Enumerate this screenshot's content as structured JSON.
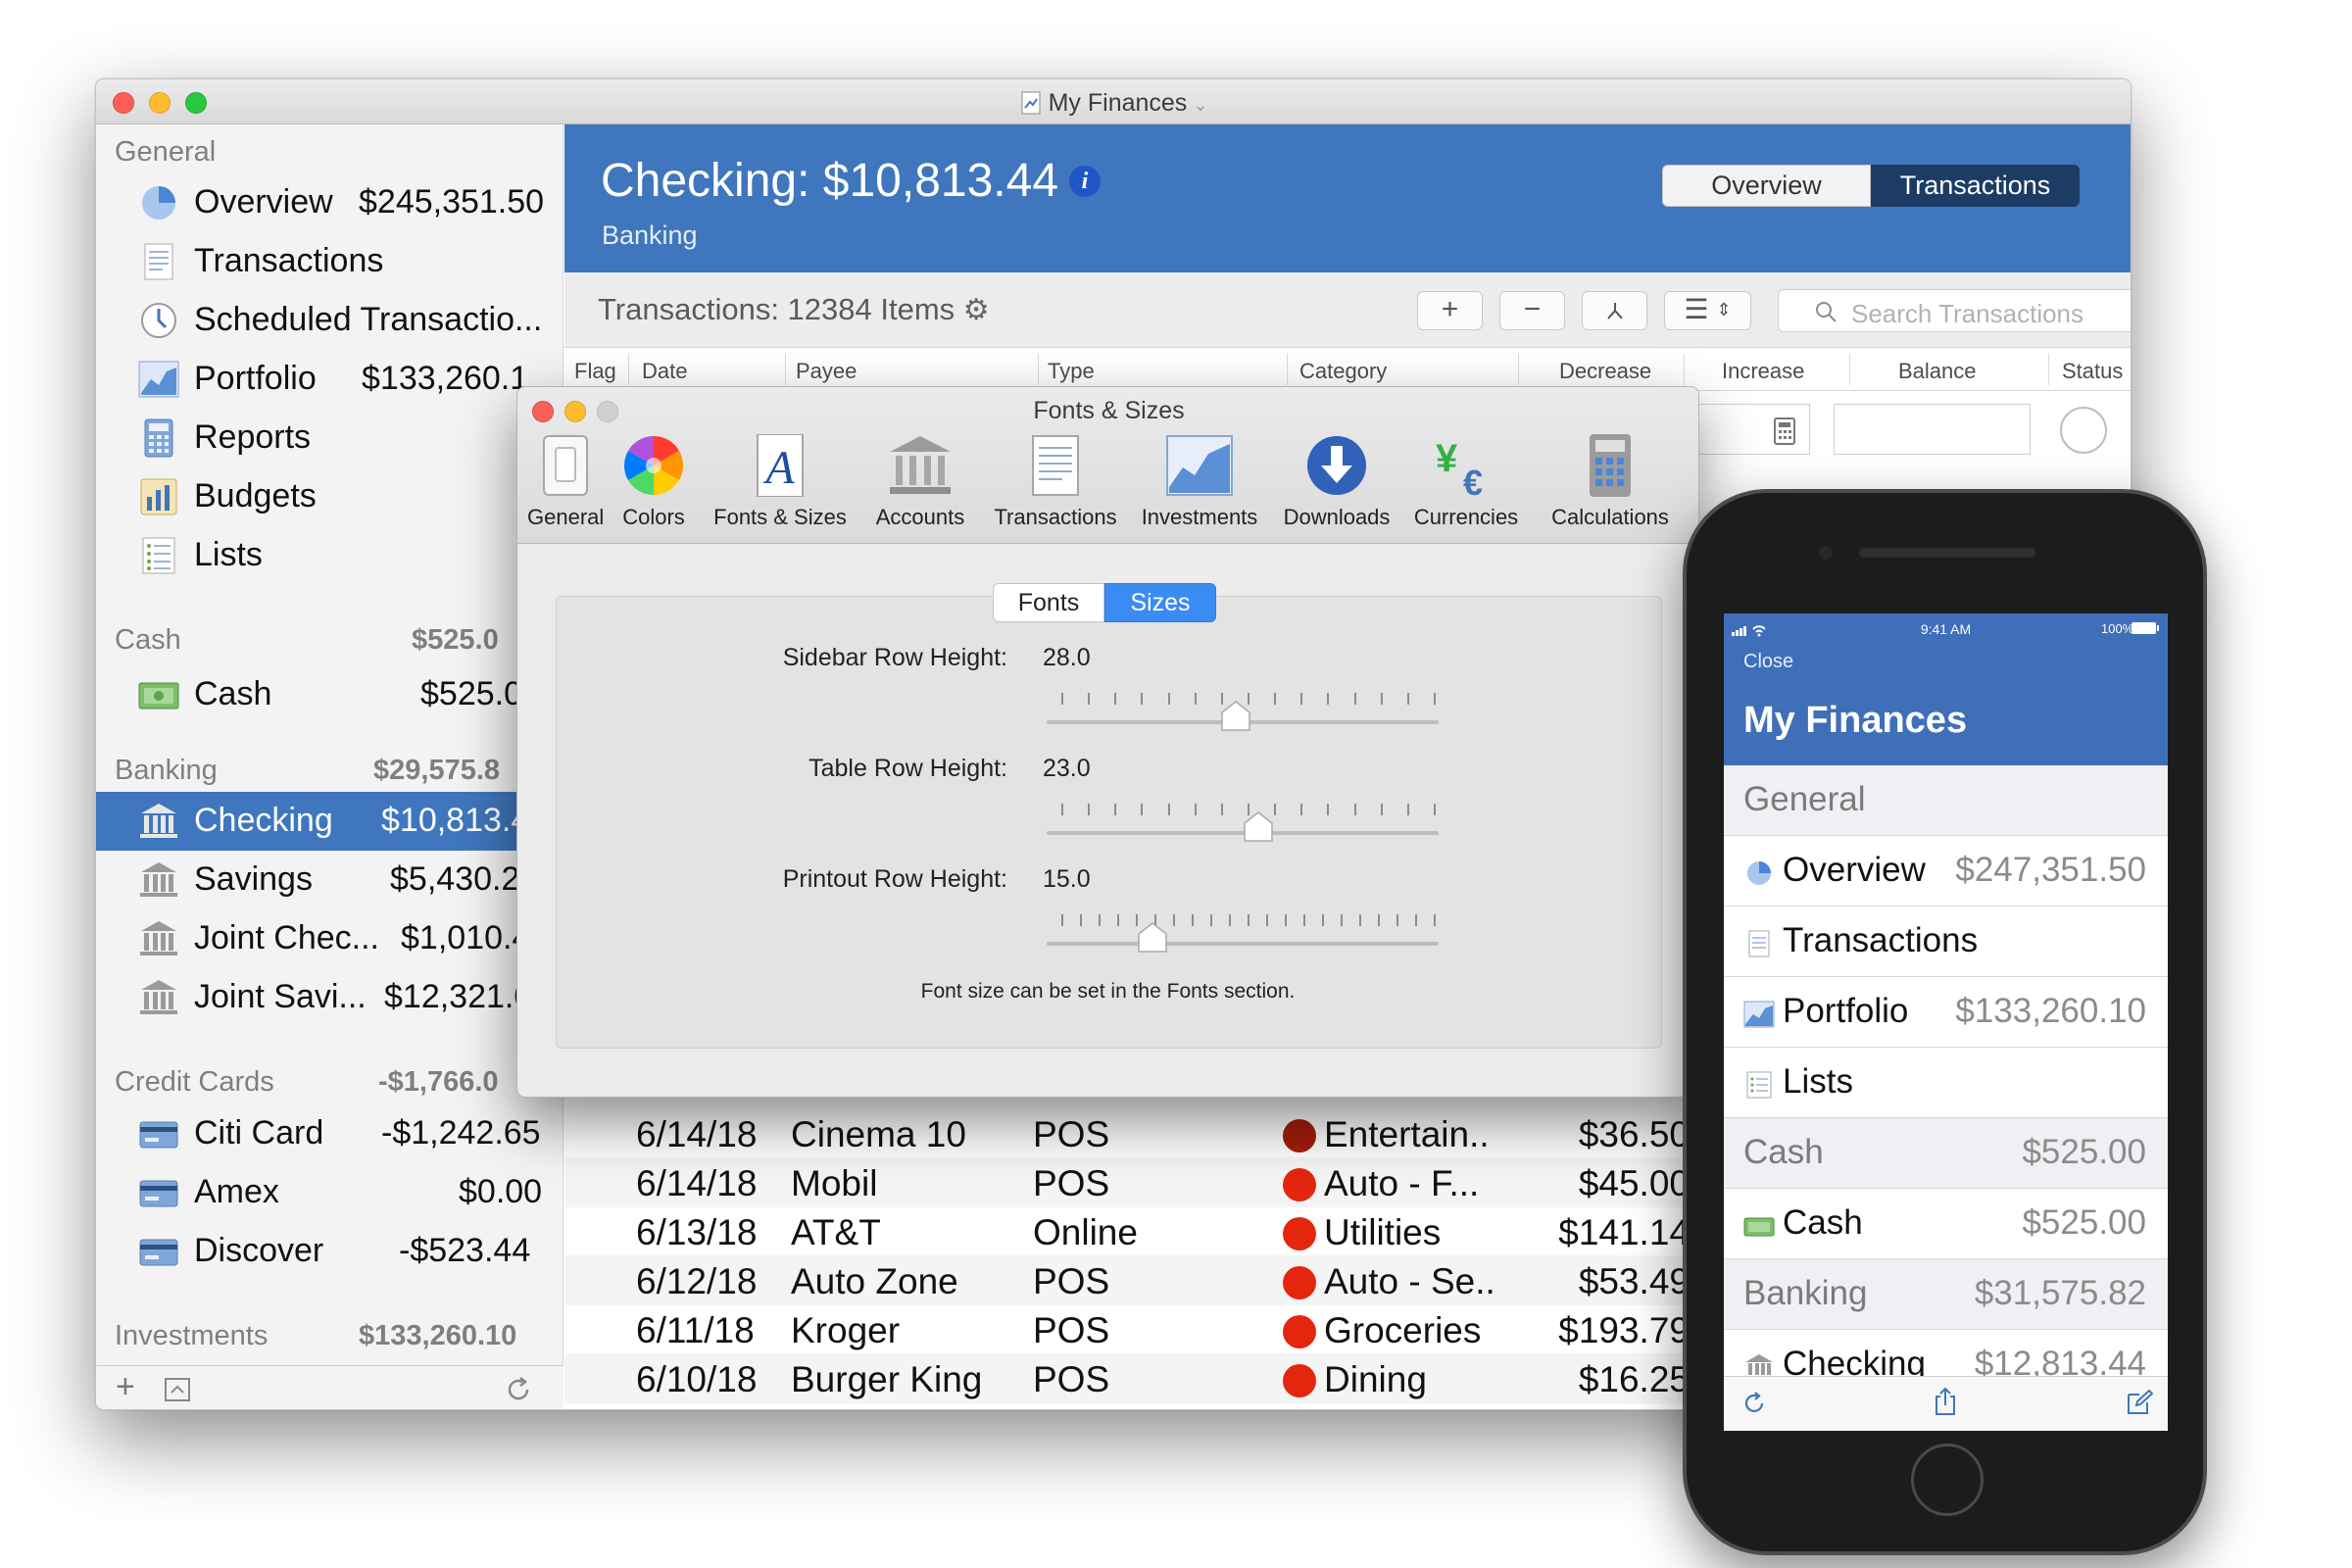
{
  "window": {
    "title": "My Finances"
  },
  "sidebar": {
    "sections": {
      "general": {
        "label": "General"
      },
      "cash": {
        "label": "Cash",
        "value": "$525.0"
      },
      "banking": {
        "label": "Banking",
        "value": "$29,575.8"
      },
      "credit": {
        "label": "Credit Cards",
        "value": "-$1,766.0"
      },
      "investments": {
        "label": "Investments",
        "value": "$133,260.10"
      }
    },
    "items": [
      {
        "label": "Overview",
        "value": "$245,351.50"
      },
      {
        "label": "Transactions",
        "value": ""
      },
      {
        "label": "Scheduled Transactio...",
        "value": ""
      },
      {
        "label": "Portfolio",
        "value": "$133,260.1"
      },
      {
        "label": "Reports",
        "value": ""
      },
      {
        "label": "Budgets",
        "value": ""
      },
      {
        "label": "Lists",
        "value": ""
      },
      {
        "label": "Cash",
        "value": "$525.0"
      },
      {
        "label": "Checking",
        "value": "$10,813.4"
      },
      {
        "label": "Savings",
        "value": "$5,430.2"
      },
      {
        "label": "Joint Chec...",
        "value": "$1,010.4"
      },
      {
        "label": "Joint Savi...",
        "value": "$12,321.0"
      },
      {
        "label": "Citi Card",
        "value": "-$1,242.65"
      },
      {
        "label": "Amex",
        "value": "$0.00"
      },
      {
        "label": "Discover",
        "value": "-$523.44"
      }
    ]
  },
  "header": {
    "title": "Checking: $10,813.44",
    "subtitle": "Banking",
    "seg_overview": "Overview",
    "seg_transactions": "Transactions"
  },
  "toolbar": {
    "count": "Transactions: 12384 Items",
    "add": "+",
    "remove": "−",
    "search_placeholder": "Search Transactions"
  },
  "table": {
    "columns": [
      "Flag",
      "Date",
      "Payee",
      "Type",
      "Category",
      "Decrease",
      "Increase",
      "Balance",
      "Status"
    ],
    "rows": [
      {
        "date": "6/14/18",
        "payee": "Cinema 10",
        "type": "POS",
        "category": "Entertain..",
        "amount": "$36.50"
      },
      {
        "date": "6/14/18",
        "payee": "Mobil",
        "type": "POS",
        "category": "Auto - F...",
        "amount": "$45.00"
      },
      {
        "date": "6/13/18",
        "payee": "AT&T",
        "type": "Online",
        "category": "Utilities",
        "amount": "$141.14"
      },
      {
        "date": "6/12/18",
        "payee": "Auto Zone",
        "type": "POS",
        "category": "Auto - Se..",
        "amount": "$53.49"
      },
      {
        "date": "6/11/18",
        "payee": "Kroger",
        "type": "POS",
        "category": "Groceries",
        "amount": "$193.79"
      },
      {
        "date": "6/10/18",
        "payee": "Burger King",
        "type": "POS",
        "category": "Dining",
        "amount": "$16.25"
      }
    ]
  },
  "prefs": {
    "title": "Fonts & Sizes",
    "tabs": [
      "General",
      "Colors",
      "Fonts & Sizes",
      "Accounts",
      "Transactions",
      "Investments",
      "Downloads",
      "Currencies",
      "Calculations"
    ],
    "seg_fonts": "Fonts",
    "seg_sizes": "Sizes",
    "sidebar_label": "Sidebar Row Height:",
    "sidebar_value": "28.0",
    "table_label": "Table Row Height:",
    "table_value": "23.0",
    "printout_label": "Printout Row Height:",
    "printout_value": "15.0",
    "note": "Font size can be set in the Fonts section."
  },
  "phone": {
    "status_time": "9:41 AM",
    "status_battery": "100%",
    "close": "Close",
    "title": "My Finances",
    "rows": [
      {
        "label": "General",
        "value": "",
        "header": true
      },
      {
        "label": "Overview",
        "value": "$247,351.50"
      },
      {
        "label": "Transactions",
        "value": ""
      },
      {
        "label": "Portfolio",
        "value": "$133,260.10"
      },
      {
        "label": "Lists",
        "value": ""
      },
      {
        "label": "Cash",
        "value": "$525.00",
        "header": true
      },
      {
        "label": "Cash",
        "value": "$525.00"
      },
      {
        "label": "Banking",
        "value": "$31,575.82",
        "header": true
      },
      {
        "label": "Checking",
        "value": "$12,813.44"
      }
    ]
  },
  "colors": {
    "accent": "#3f76bd",
    "selected_segment": "#1c3c66",
    "sizes_segment": "#3b8bf4",
    "dot": "#e4260e"
  }
}
